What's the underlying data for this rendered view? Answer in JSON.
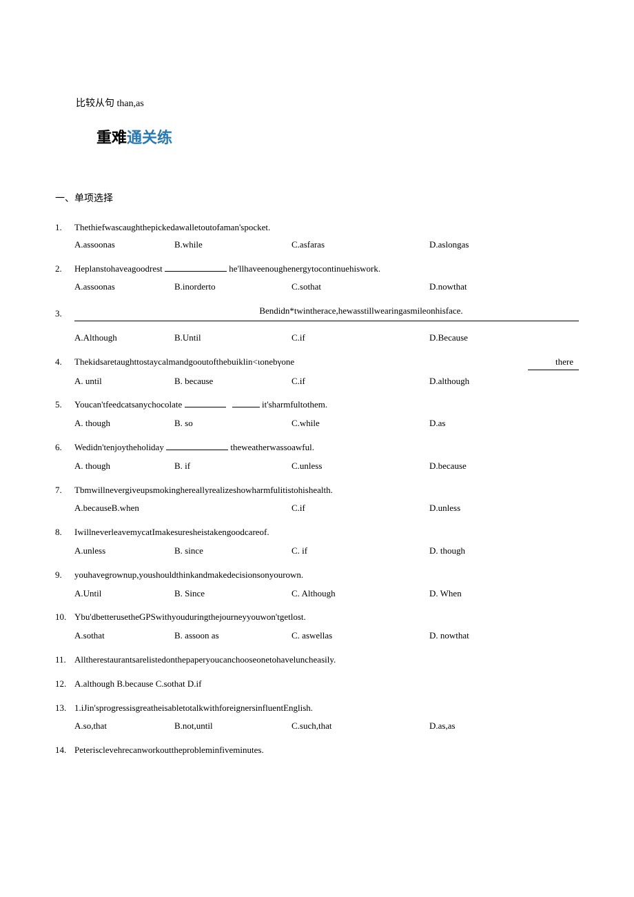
{
  "top_note": "比较从句 than,as",
  "title_main": "重难",
  "title_accent": "通关练",
  "section_head": "一、单项选择",
  "questions": [
    {
      "num": "1.",
      "stem": "Thethiefwascaughthepickedawalletoutofaman'spocket.",
      "opts": [
        "A.assoonas",
        "B.while",
        "C.asfaras",
        "D.aslongas"
      ]
    },
    {
      "num": "2.",
      "stem_pre": "Heplanstohaveagoodrest",
      "stem_post": "he'llhaveenoughenergytocontinuehiswork.",
      "opts": [
        "A.assoonas",
        "B.inorderto",
        "C.sothat",
        "D.nowthat"
      ]
    },
    {
      "num": "3.",
      "stem_above": "Bendidn*twintherace,hewasstillwearingasmileonhisface.",
      "opts": [
        "A.Although",
        "B.Until",
        "C.if",
        "D.Because"
      ]
    },
    {
      "num": "4.",
      "stem": "Thekidsaretaughttostaycalmandgooutofthebuiklin<ιonebγone",
      "trailing": "there",
      "opts": [
        "A.    until",
        "B.   because",
        "C.if",
        "D.although"
      ]
    },
    {
      "num": "5.",
      "stem_pre": "Youcan'tfeedcatsanychocolate",
      "stem_post": "it'sharmfultothem.",
      "opts": [
        "A.    though",
        "B.   so",
        "C.while",
        "D.as"
      ]
    },
    {
      "num": "6.",
      "stem_pre": "Wedidn'tenjoytheholiday",
      "stem_post": "theweatherwassoawful.",
      "opts": [
        "A.    though",
        "B.   if",
        "C.unless",
        "D.because"
      ]
    },
    {
      "num": "7.",
      "stem": "Tbmwillnevergiveupsmokinghereallyrealizeshowharmfulitistohishealth.",
      "opts": [
        "A.becauseB.when",
        "",
        "C.if",
        "D.unless"
      ]
    },
    {
      "num": "8.",
      "stem": "IwillneverleavemycatImakesuresheistakengoodcareof.",
      "opts": [
        "A.unless",
        "B.    since",
        "C.    if",
        "D.    though"
      ]
    },
    {
      "num": "9.",
      "stem": "youhavegrownup,youshouldthinkandmakedecisionsonyourown.",
      "opts": [
        "A.Until",
        "B.    Since",
        "C.    Although",
        "D.    When"
      ]
    },
    {
      "num": "10.",
      "stem": "Ybu'dbetterusetheGPSwithyouduringthejourneyyouwon'tgetlost.",
      "opts": [
        "A.sothat",
        "B.    assoon    as",
        "C.    aswellas",
        "D.    nowthat"
      ]
    },
    {
      "num": "11.",
      "stem": "Alltherestaurantsarelistedonthepaperyoucanchooseonetohaveluncheasily."
    },
    {
      "num": "12.",
      "stem": "A.although  B.because          C.sothat D.if"
    },
    {
      "num": "13.",
      "stem": "1.iJin'sprogressisgreatheisabletotalkwithforeignersinfluentEnglish.",
      "opts": [
        "A.so,that",
        "B.not,until",
        "C.such,that",
        "D.as,as"
      ]
    },
    {
      "num": "14.",
      "stem": "Peterisclevehrecanworkouttheprobleminfiveminutes."
    }
  ]
}
